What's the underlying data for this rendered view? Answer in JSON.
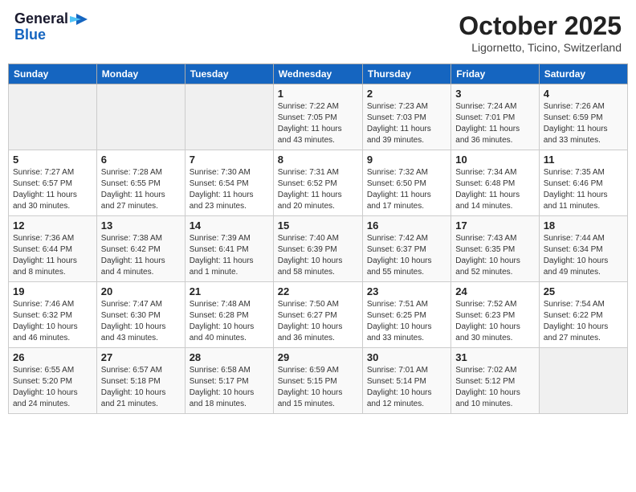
{
  "header": {
    "logo_line1": "General",
    "logo_line2": "Blue",
    "month": "October 2025",
    "location": "Ligornetto, Ticino, Switzerland"
  },
  "weekdays": [
    "Sunday",
    "Monday",
    "Tuesday",
    "Wednesday",
    "Thursday",
    "Friday",
    "Saturday"
  ],
  "weeks": [
    [
      {
        "day": "",
        "info": ""
      },
      {
        "day": "",
        "info": ""
      },
      {
        "day": "",
        "info": ""
      },
      {
        "day": "1",
        "info": "Sunrise: 7:22 AM\nSunset: 7:05 PM\nDaylight: 11 hours\nand 43 minutes."
      },
      {
        "day": "2",
        "info": "Sunrise: 7:23 AM\nSunset: 7:03 PM\nDaylight: 11 hours\nand 39 minutes."
      },
      {
        "day": "3",
        "info": "Sunrise: 7:24 AM\nSunset: 7:01 PM\nDaylight: 11 hours\nand 36 minutes."
      },
      {
        "day": "4",
        "info": "Sunrise: 7:26 AM\nSunset: 6:59 PM\nDaylight: 11 hours\nand 33 minutes."
      }
    ],
    [
      {
        "day": "5",
        "info": "Sunrise: 7:27 AM\nSunset: 6:57 PM\nDaylight: 11 hours\nand 30 minutes."
      },
      {
        "day": "6",
        "info": "Sunrise: 7:28 AM\nSunset: 6:55 PM\nDaylight: 11 hours\nand 27 minutes."
      },
      {
        "day": "7",
        "info": "Sunrise: 7:30 AM\nSunset: 6:54 PM\nDaylight: 11 hours\nand 23 minutes."
      },
      {
        "day": "8",
        "info": "Sunrise: 7:31 AM\nSunset: 6:52 PM\nDaylight: 11 hours\nand 20 minutes."
      },
      {
        "day": "9",
        "info": "Sunrise: 7:32 AM\nSunset: 6:50 PM\nDaylight: 11 hours\nand 17 minutes."
      },
      {
        "day": "10",
        "info": "Sunrise: 7:34 AM\nSunset: 6:48 PM\nDaylight: 11 hours\nand 14 minutes."
      },
      {
        "day": "11",
        "info": "Sunrise: 7:35 AM\nSunset: 6:46 PM\nDaylight: 11 hours\nand 11 minutes."
      }
    ],
    [
      {
        "day": "12",
        "info": "Sunrise: 7:36 AM\nSunset: 6:44 PM\nDaylight: 11 hours\nand 8 minutes."
      },
      {
        "day": "13",
        "info": "Sunrise: 7:38 AM\nSunset: 6:42 PM\nDaylight: 11 hours\nand 4 minutes."
      },
      {
        "day": "14",
        "info": "Sunrise: 7:39 AM\nSunset: 6:41 PM\nDaylight: 11 hours\nand 1 minute."
      },
      {
        "day": "15",
        "info": "Sunrise: 7:40 AM\nSunset: 6:39 PM\nDaylight: 10 hours\nand 58 minutes."
      },
      {
        "day": "16",
        "info": "Sunrise: 7:42 AM\nSunset: 6:37 PM\nDaylight: 10 hours\nand 55 minutes."
      },
      {
        "day": "17",
        "info": "Sunrise: 7:43 AM\nSunset: 6:35 PM\nDaylight: 10 hours\nand 52 minutes."
      },
      {
        "day": "18",
        "info": "Sunrise: 7:44 AM\nSunset: 6:34 PM\nDaylight: 10 hours\nand 49 minutes."
      }
    ],
    [
      {
        "day": "19",
        "info": "Sunrise: 7:46 AM\nSunset: 6:32 PM\nDaylight: 10 hours\nand 46 minutes."
      },
      {
        "day": "20",
        "info": "Sunrise: 7:47 AM\nSunset: 6:30 PM\nDaylight: 10 hours\nand 43 minutes."
      },
      {
        "day": "21",
        "info": "Sunrise: 7:48 AM\nSunset: 6:28 PM\nDaylight: 10 hours\nand 40 minutes."
      },
      {
        "day": "22",
        "info": "Sunrise: 7:50 AM\nSunset: 6:27 PM\nDaylight: 10 hours\nand 36 minutes."
      },
      {
        "day": "23",
        "info": "Sunrise: 7:51 AM\nSunset: 6:25 PM\nDaylight: 10 hours\nand 33 minutes."
      },
      {
        "day": "24",
        "info": "Sunrise: 7:52 AM\nSunset: 6:23 PM\nDaylight: 10 hours\nand 30 minutes."
      },
      {
        "day": "25",
        "info": "Sunrise: 7:54 AM\nSunset: 6:22 PM\nDaylight: 10 hours\nand 27 minutes."
      }
    ],
    [
      {
        "day": "26",
        "info": "Sunrise: 6:55 AM\nSunset: 5:20 PM\nDaylight: 10 hours\nand 24 minutes."
      },
      {
        "day": "27",
        "info": "Sunrise: 6:57 AM\nSunset: 5:18 PM\nDaylight: 10 hours\nand 21 minutes."
      },
      {
        "day": "28",
        "info": "Sunrise: 6:58 AM\nSunset: 5:17 PM\nDaylight: 10 hours\nand 18 minutes."
      },
      {
        "day": "29",
        "info": "Sunrise: 6:59 AM\nSunset: 5:15 PM\nDaylight: 10 hours\nand 15 minutes."
      },
      {
        "day": "30",
        "info": "Sunrise: 7:01 AM\nSunset: 5:14 PM\nDaylight: 10 hours\nand 12 minutes."
      },
      {
        "day": "31",
        "info": "Sunrise: 7:02 AM\nSunset: 5:12 PM\nDaylight: 10 hours\nand 10 minutes."
      },
      {
        "day": "",
        "info": ""
      }
    ]
  ]
}
